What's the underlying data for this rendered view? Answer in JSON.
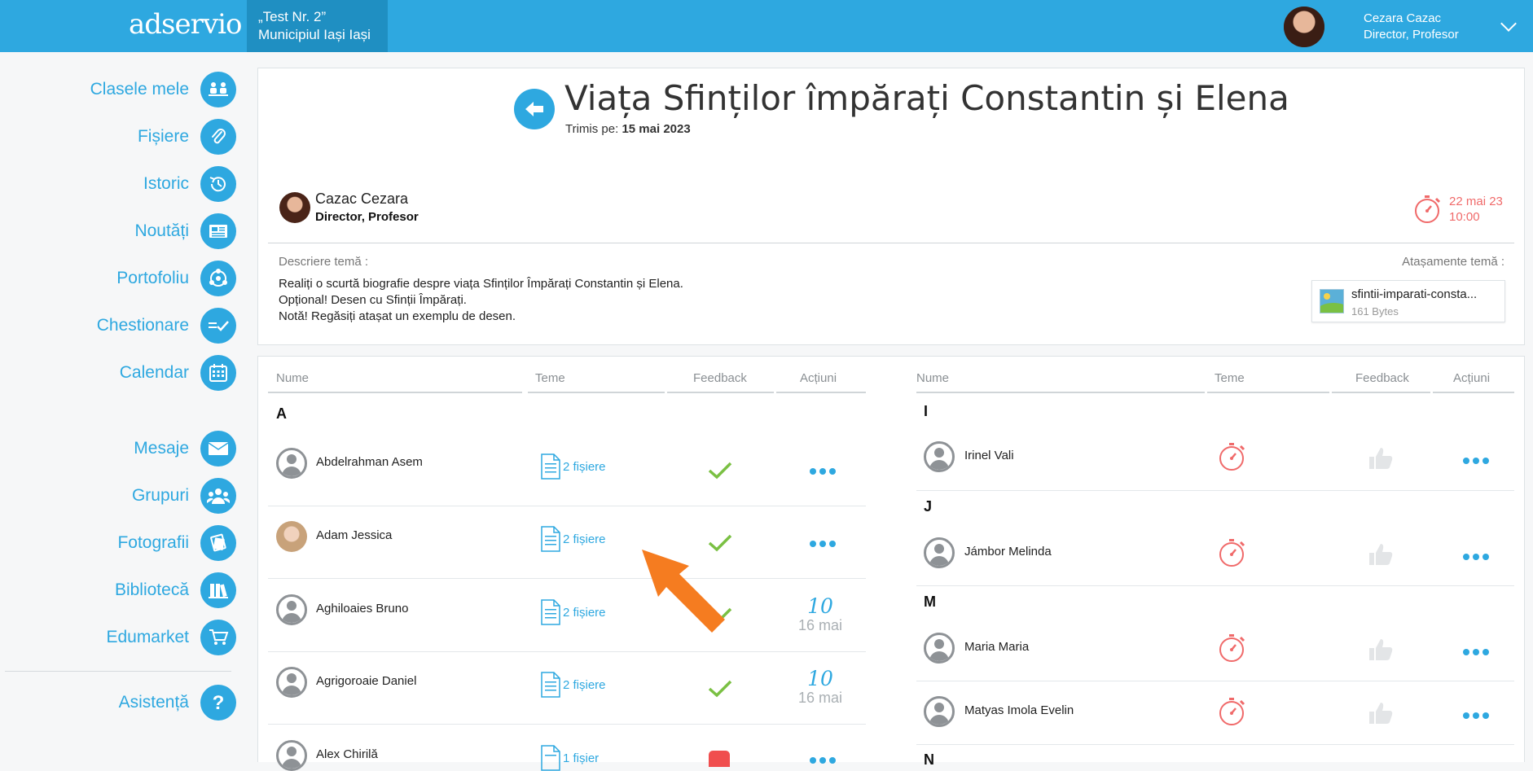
{
  "header": {
    "logo": "adservio",
    "school_line1": "„Test Nr. 2”",
    "school_line2": "Municipiul Iași Iași",
    "user_name": "Cezara Cazac",
    "user_role": "Director, Profesor"
  },
  "sidebar": {
    "items": [
      {
        "label": "Clasele mele",
        "icon": "classroom-icon"
      },
      {
        "label": "Fișiere",
        "icon": "paperclip-icon"
      },
      {
        "label": "Istoric",
        "icon": "history-icon"
      },
      {
        "label": "Noutăți",
        "icon": "news-icon"
      },
      {
        "label": "Portofoliu",
        "icon": "portfolio-icon"
      },
      {
        "label": "Chestionare",
        "icon": "survey-icon"
      },
      {
        "label": "Calendar",
        "icon": "calendar-icon"
      },
      {
        "label": "Mesaje",
        "icon": "envelope-icon"
      },
      {
        "label": "Grupuri",
        "icon": "groups-icon"
      },
      {
        "label": "Fotografii",
        "icon": "photos-icon"
      },
      {
        "label": "Bibliotecă",
        "icon": "library-icon"
      },
      {
        "label": "Edumarket",
        "icon": "cart-icon"
      },
      {
        "label": "Asistență",
        "icon": "help-icon"
      }
    ]
  },
  "homework": {
    "title": "Viața Sfinților împărați Constantin și Elena",
    "sent_label": "Trimis pe:",
    "sent_date": "15 mai 2023",
    "author_name": "Cazac Cezara",
    "author_role": "Director, Profesor",
    "deadline_date": "22 mai 23",
    "deadline_time": "10:00",
    "description_label": "Descriere temă :",
    "description_lines": [
      "Realiți o scurtă biografie despre viața Sfinților Împărați Constantin și Elena.",
      "Opțional! Desen cu Sfinții Împărați.",
      "Notă! Regăsiți atașat un exemplu de desen."
    ],
    "attachments_label": "Atașamente temă :",
    "attachment_name": "sfintii-imparati-consta...",
    "attachment_size": "161 Bytes"
  },
  "table": {
    "headers": [
      "Nume",
      "Teme",
      "Feedback",
      "Acțiuni"
    ],
    "left": [
      {
        "letter": "A"
      },
      {
        "name": "Abdelrahman Asem",
        "files": "2 fișiere",
        "feedback": "check",
        "action": "dots"
      },
      {
        "name": "Adam Jessica",
        "files": "2 fișiere",
        "feedback": "check",
        "action": "dots"
      },
      {
        "name": "Aghiloaies Bruno",
        "files": "2 fișiere",
        "feedback": "check",
        "grade": "10",
        "grade_date": "16 mai"
      },
      {
        "name": "Agrigoroaie Daniel",
        "files": "2 fișiere",
        "feedback": "check",
        "grade": "10",
        "grade_date": "16 mai"
      },
      {
        "name": "Alex Chirilă",
        "files": "1 fișier",
        "feedback": "red-thumb",
        "action": "dots"
      }
    ],
    "right": [
      {
        "letter": "I"
      },
      {
        "name": "Irinel Vali",
        "status": "timer",
        "feedback": "thumb",
        "action": "dots"
      },
      {
        "letter": "J"
      },
      {
        "name": "Jámbor Melinda",
        "status": "timer",
        "feedback": "thumb",
        "action": "dots"
      },
      {
        "letter": "M"
      },
      {
        "name": "Maria Maria",
        "status": "timer",
        "feedback": "thumb",
        "action": "dots"
      },
      {
        "name": "Matyas Imola Evelin",
        "status": "timer",
        "feedback": "thumb",
        "action": "dots"
      },
      {
        "letter": "N"
      }
    ]
  },
  "colors": {
    "brand": "#2ea8e0",
    "deadline": "#f06a6a",
    "check": "#7ac043",
    "annotation_arrow": "#f57c20"
  }
}
